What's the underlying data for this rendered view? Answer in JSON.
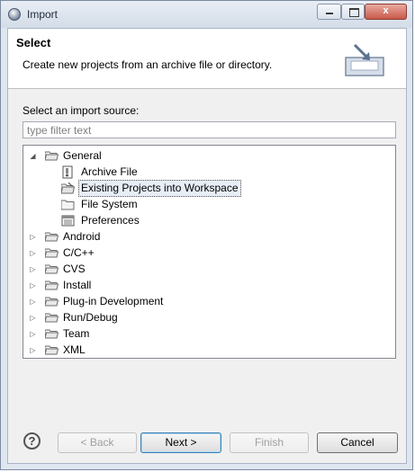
{
  "window": {
    "title": "Import",
    "close_glyph": "x"
  },
  "header": {
    "title": "Select",
    "description": "Create new projects from an archive file or directory.",
    "banner_icon": "import-wizard-icon"
  },
  "source": {
    "label": "Select an import source:",
    "filter_placeholder": "type filter text",
    "filter_value": ""
  },
  "tree": {
    "general": {
      "label": "General",
      "children": {
        "archive_file": "Archive File",
        "existing_projects": "Existing Projects into Workspace",
        "file_system": "File System",
        "preferences": "Preferences"
      }
    },
    "android": "Android",
    "cpp": "C/C++",
    "cvs": "CVS",
    "install": "Install",
    "plugin_dev": "Plug-in Development",
    "run_debug": "Run/Debug",
    "team": "Team",
    "xml": "XML",
    "selected_item": "Existing Projects into Workspace"
  },
  "buttons": {
    "help": "?",
    "back": "< Back",
    "next": "Next >",
    "finish": "Finish",
    "cancel": "Cancel"
  },
  "colors": {
    "selection": "#e8eef7",
    "titlebar": "#dfe6ef"
  }
}
